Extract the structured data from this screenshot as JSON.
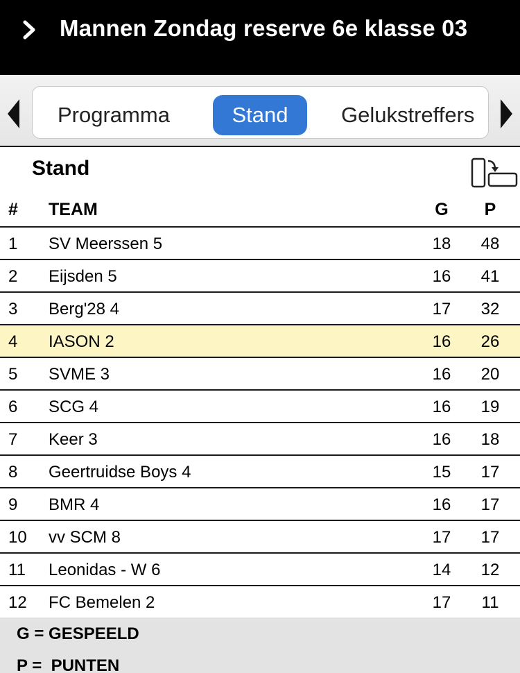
{
  "header": {
    "title": "Mannen Zondag reserve 6e klasse 03",
    "back_icon": "chevron-right-icon"
  },
  "tabs": [
    {
      "label": "Programma",
      "active": false
    },
    {
      "label": "Stand",
      "active": true
    },
    {
      "label": "Gelukstreffers",
      "active": false
    }
  ],
  "colors": {
    "accent": "#3478d6",
    "highlight_row": "#fdf6c4",
    "header_bg": "#000000",
    "legend_bg": "#e3e3e3"
  },
  "section": {
    "title": "Stand",
    "rotate_icon": "rotate-device-icon"
  },
  "table": {
    "columns": [
      "#",
      "TEAM",
      "G",
      "P"
    ],
    "rows": [
      {
        "pos": "1",
        "team": "SV Meerssen 5",
        "g": "18",
        "p": "48"
      },
      {
        "pos": "2",
        "team": "Eijsden 5",
        "g": "16",
        "p": "41"
      },
      {
        "pos": "3",
        "team": "Berg'28 4",
        "g": "17",
        "p": "32"
      },
      {
        "pos": "4",
        "team": "IASON 2",
        "g": "16",
        "p": "26",
        "highlight": true
      },
      {
        "pos": "5",
        "team": "SVME 3",
        "g": "16",
        "p": "20"
      },
      {
        "pos": "6",
        "team": "SCG 4",
        "g": "16",
        "p": "19"
      },
      {
        "pos": "7",
        "team": "Keer 3",
        "g": "16",
        "p": "18"
      },
      {
        "pos": "8",
        "team": "Geertruidse Boys 4",
        "g": "15",
        "p": "17"
      },
      {
        "pos": "9",
        "team": "BMR 4",
        "g": "16",
        "p": "17"
      },
      {
        "pos": "10",
        "team": "vv SCM 8",
        "g": "17",
        "p": "17"
      },
      {
        "pos": "11",
        "team": "Leonidas - W 6",
        "g": "14",
        "p": "12"
      },
      {
        "pos": "12",
        "team": "FC Bemelen 2",
        "g": "17",
        "p": "11"
      }
    ]
  },
  "legend": {
    "line1": "G = GESPEELD",
    "line2": "P =  PUNTEN"
  }
}
